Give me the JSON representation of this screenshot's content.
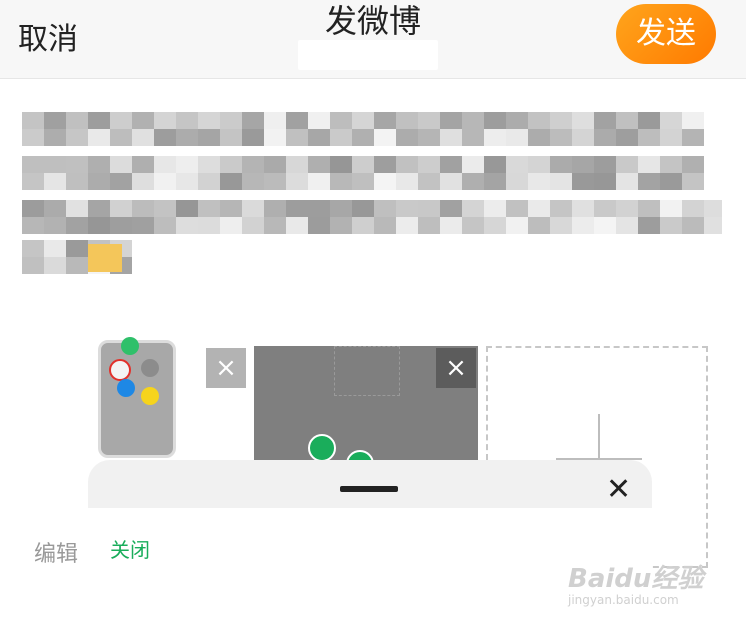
{
  "header": {
    "cancel_label": "取消",
    "title": "发微博",
    "send_label": "发送"
  },
  "bottom_sheet": {
    "close_link_label": "关闭",
    "close_icon": "close-icon"
  },
  "background_ui": {
    "edit_label": "编辑"
  },
  "watermark": {
    "brand_text": "Baidu经验",
    "url_text": "jingyan.baidu.com"
  },
  "colors": {
    "send_gradient_start": "#ffa51c",
    "send_gradient_end": "#ff7a00",
    "close_link": "#1aad5b"
  }
}
